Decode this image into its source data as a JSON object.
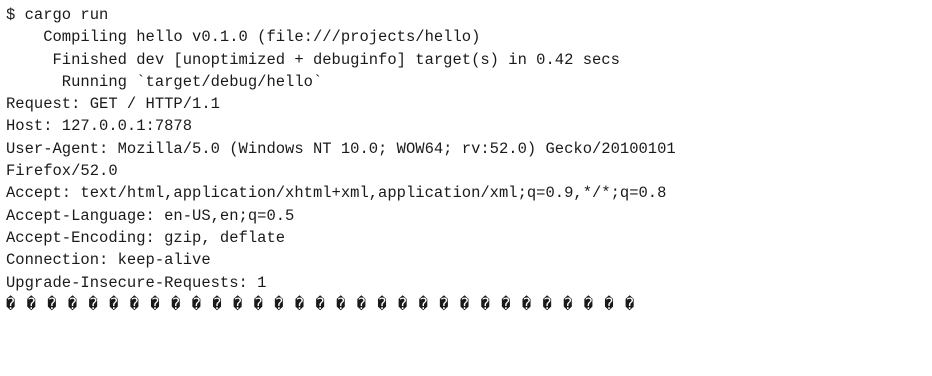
{
  "terminal": {
    "lines": [
      "$ cargo run",
      "    Compiling hello v0.1.0 (file:///projects/hello)",
      "     Finished dev [unoptimized + debuginfo] target(s) in 0.42 secs",
      "      Running `target/debug/hello`",
      "Request: GET / HTTP/1.1",
      "Host: 127.0.0.1:7878",
      "User-Agent: Mozilla/5.0 (Windows NT 10.0; WOW64; rv:52.0) Gecko/20100101",
      "Firefox/52.0",
      "Accept: text/html,application/xhtml+xml,application/xml;q=0.9,*/*;q=0.8",
      "Accept-Language: en-US,en;q=0.5",
      "Accept-Encoding: gzip, deflate",
      "Connection: keep-alive",
      "Upgrade-Insecure-Requests: 1",
      "� � � � � � � � � � � � � � � � � � � � � � � � � � � � � � �"
    ]
  }
}
